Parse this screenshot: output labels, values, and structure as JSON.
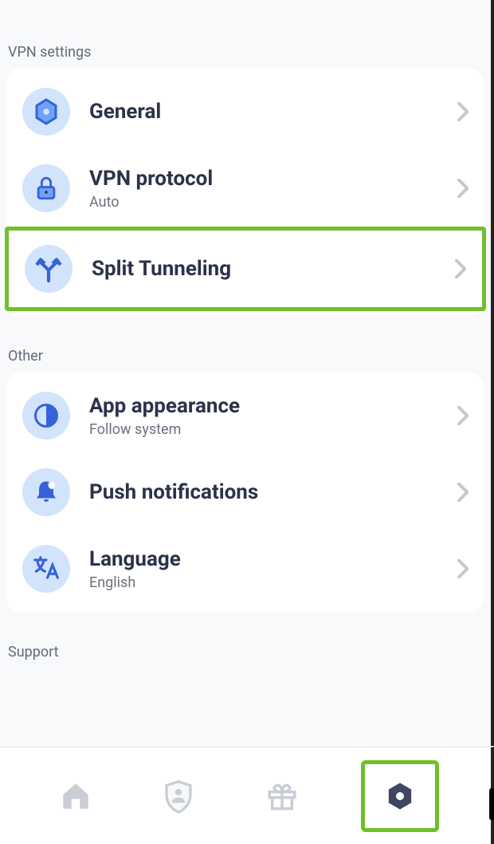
{
  "sections": {
    "vpn": {
      "label": "VPN settings",
      "items": [
        {
          "title": "General",
          "sub": ""
        },
        {
          "title": "VPN protocol",
          "sub": "Auto"
        },
        {
          "title": "Split Tunneling",
          "sub": ""
        }
      ]
    },
    "other": {
      "label": "Other",
      "items": [
        {
          "title": "App appearance",
          "sub": "Follow system"
        },
        {
          "title": "Push notifications",
          "sub": ""
        },
        {
          "title": "Language",
          "sub": "English"
        }
      ]
    },
    "support": {
      "label": "Support"
    }
  },
  "highlight": {
    "row": "split-tunneling",
    "nav": "settings"
  },
  "colors": {
    "iconBg": "#d1e4fb",
    "iconFg": "#3862d8",
    "highlight": "#6fbf2a",
    "titleText": "#2b324a"
  }
}
